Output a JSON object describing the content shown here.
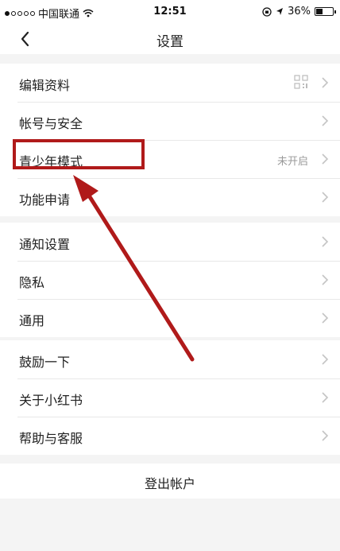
{
  "status_bar": {
    "carrier": "中国联通",
    "time": "12:51",
    "battery_pct": "36%"
  },
  "header": {
    "title": "设置"
  },
  "groups": [
    {
      "items": [
        {
          "label": "编辑资料",
          "value": "",
          "icon": "qr-code-icon"
        },
        {
          "label": "帐号与安全",
          "value": ""
        },
        {
          "label": "青少年模式",
          "value": "未开启"
        },
        {
          "label": "功能申请",
          "value": ""
        }
      ]
    },
    {
      "items": [
        {
          "label": "通知设置"
        },
        {
          "label": "隐私"
        },
        {
          "label": "通用"
        }
      ]
    },
    {
      "items": [
        {
          "label": "鼓励一下"
        },
        {
          "label": "关于小红书"
        },
        {
          "label": "帮助与客服"
        }
      ]
    }
  ],
  "logout": {
    "label": "登出帐户"
  },
  "annotation": {
    "color": "#b01a1a"
  }
}
